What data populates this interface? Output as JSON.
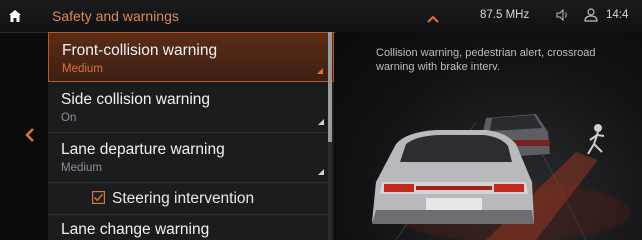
{
  "header": {
    "title": "Safety and warnings",
    "frequency": "87.5 MHz",
    "clock": "14:4"
  },
  "list": {
    "items": [
      {
        "label": "Front-collision warning",
        "value": "Medium"
      },
      {
        "label": "Side collision warning",
        "value": "On"
      },
      {
        "label": "Lane departure warning",
        "value": "Medium"
      },
      {
        "label": "Steering intervention"
      },
      {
        "label": "Lane change warning"
      }
    ]
  },
  "info": {
    "description": "Collision warning, pedestrian alert, crossroad warning with brake interv."
  },
  "colors": {
    "accent": "#d9743d",
    "selected_bg": "#4a2516",
    "panel_bg": "#1b1c1e"
  }
}
